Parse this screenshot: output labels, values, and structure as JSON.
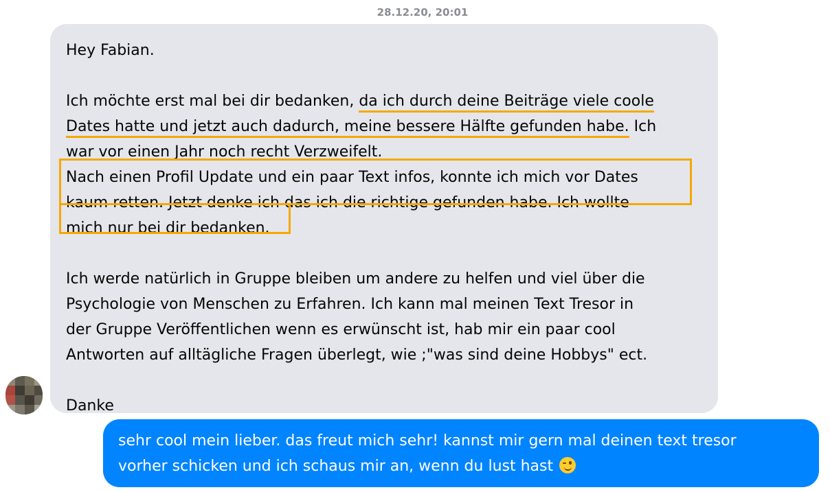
{
  "timestamp": "28.12.20, 20:01",
  "incoming_message": {
    "greeting": "Hey Fabian.",
    "p1_l1_a": "Ich möchte erst mal bei dir bedanken, ",
    "p1_l1_b": "da ich durch deine Beiträge viele coole",
    "p1_l2_a": "Dates hatte und jetzt auch dadurch, meine bessere Hälfte gefunden habe.",
    "p1_l2_b": " Ich",
    "p1_l3": "war vor einen Jahr noch recht Verzweifelt.",
    "p2_l1": "Nach einen Profil  Update und ein paar Text infos, konnte ich mich vor Dates",
    "p2_l2": "kaum retten. Jetzt denke ich das ich die richtige gefunden habe. Ich wollte",
    "p2_l3": "mich nur bei dir bedanken.",
    "p3_l1": "Ich werde natürlich in Gruppe bleiben um andere zu helfen und viel über die",
    "p3_l2": "Psychologie von Menschen zu Erfahren. Ich kann mal meinen Text Tresor in",
    "p3_l3": "der Gruppe Veröffentlichen wenn es erwünscht ist, hab mir ein paar cool",
    "p3_l4": "Antworten auf alltägliche Fragen überlegt, wie ;\"was sind deine Hobbys\" ect.",
    "closing": "Danke"
  },
  "outgoing_message": {
    "line1": "sehr cool mein lieber. das freut mich sehr! kannst mir gern mal deinen text tresor",
    "line2": "vorher schicken und ich schaus mir an, wenn du lust hast",
    "emoji": "winking-face-emoji"
  },
  "colors": {
    "incoming_bubble": "#e4e6eb",
    "outgoing_bubble": "#0084ff",
    "highlight": "#f5a800",
    "timestamp": "#8a8d91"
  }
}
